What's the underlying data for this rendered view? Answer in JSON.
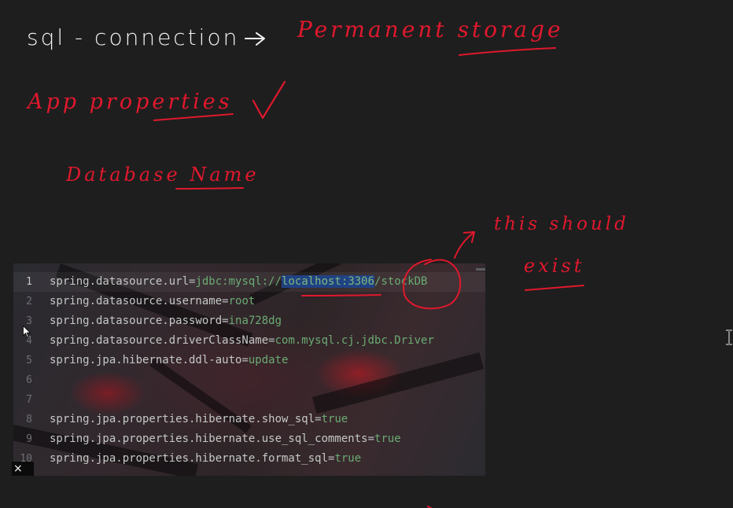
{
  "notes": {
    "line1_left": "sql - connection",
    "line1_right": "Permanent storage",
    "line2": "App properties",
    "line3": "Database Name",
    "annotation_line1": "this should",
    "annotation_line2": "exist"
  },
  "editor": {
    "lines": [
      {
        "num": "1",
        "key": "spring.datasource.url",
        "eq": "=",
        "value_pre": "jdbc:mysql://",
        "value_sel": "localhost:3306",
        "value_post": "/stockDB",
        "active": true
      },
      {
        "num": "2",
        "key": "spring.datasource.username",
        "eq": "=",
        "value": "root"
      },
      {
        "num": "3",
        "key": "spring.datasource.password",
        "eq": "=",
        "value": "ina728dg"
      },
      {
        "num": "4",
        "key": "spring.datasource.driverClassName",
        "eq": "=",
        "value": "com.mysql.cj.jdbc.Driver"
      },
      {
        "num": "5",
        "key": "spring.jpa.hibernate.ddl-auto",
        "eq": "=",
        "value": "update"
      },
      {
        "num": "6",
        "key": "",
        "eq": "",
        "value": ""
      },
      {
        "num": "7",
        "key": "",
        "eq": "",
        "value": ""
      },
      {
        "num": "8",
        "key": "spring.jpa.properties.hibernate.show_sql",
        "eq": "=",
        "value": "true"
      },
      {
        "num": "9",
        "key": "spring.jpa.properties.hibernate.use_sql_comments",
        "eq": "=",
        "value": "true"
      },
      {
        "num": "10",
        "key": "spring.jpa.properties.hibernate.format_sql",
        "eq": "=",
        "value": "true"
      }
    ]
  },
  "controls": {
    "close_glyph": "×"
  },
  "colors": {
    "ink_red": "#e0182d",
    "ink_white": "#f2f2f2",
    "code_key": "#c5c8c6",
    "code_value": "#6aab73",
    "selection": "#214283"
  }
}
